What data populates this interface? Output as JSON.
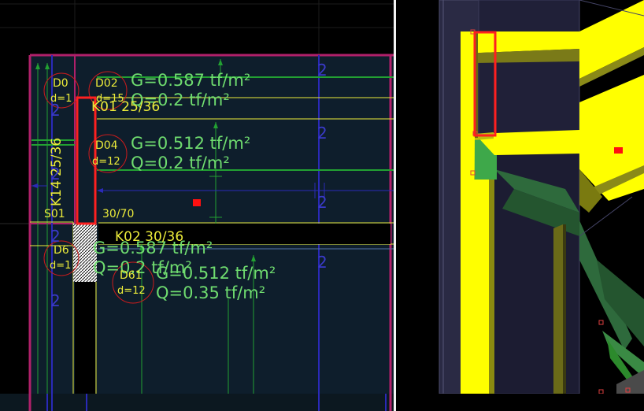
{
  "plan": {
    "slabs": {
      "d0": {
        "name": "D0",
        "thickness": "d=1"
      },
      "d02": {
        "name": "D02",
        "thickness": "d=15",
        "load_g": "G=0.587 tf/m²",
        "load_q": "Q=0.2 tf/m²"
      },
      "d04": {
        "name": "D04",
        "thickness": "d=12",
        "load_g": "G=0.512 tf/m²",
        "load_q": "Q=0.2 tf/m²"
      },
      "d62": {
        "name": "D6",
        "thickness": "d=1",
        "load_g": "G=0.587 tf/m²",
        "load_q": "Q=0.2 tf/m²"
      },
      "d61": {
        "name": "D61",
        "thickness": "d=12",
        "load_g": "G=0.512 tf/m²",
        "load_q": "Q=0.35 tf/m²"
      }
    },
    "beams": {
      "k01": "K01 25/36",
      "k02": "K02 30/36",
      "k14": "K14 25/36"
    },
    "column": {
      "name": "S01",
      "size": "30/70"
    },
    "axis_markers": [
      "2",
      "2",
      "2",
      "2",
      "2",
      "2",
      "2",
      "2"
    ]
  },
  "colors": {
    "background": "#000000",
    "frame": "#b0206a",
    "slab_fill": "#0e1e2c",
    "load_text": "#6fdc6f",
    "beam_line": "#ecec3a",
    "selection": "#ff2020",
    "column_3d": "#ffff00",
    "beam_3d": "#2e6a3c"
  }
}
